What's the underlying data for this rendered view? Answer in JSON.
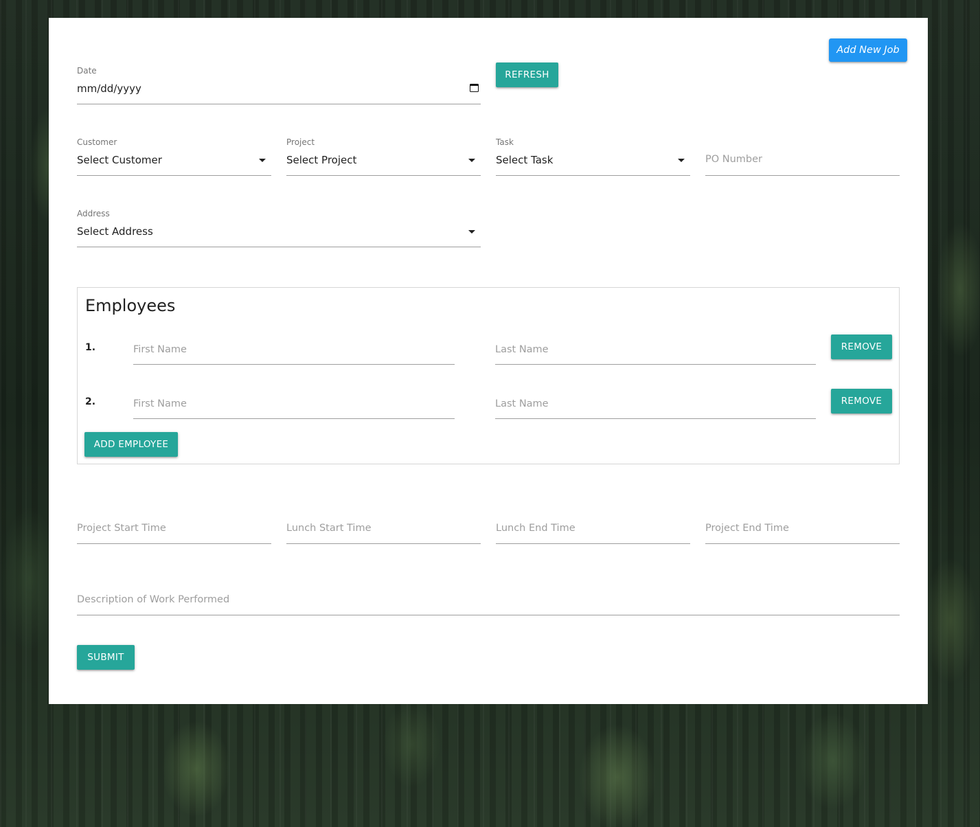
{
  "header": {
    "add_job_label": "Add New Job"
  },
  "date": {
    "label": "Date",
    "value": "mm/dd/yyyy"
  },
  "refresh_label": "REFRESH",
  "customer": {
    "label": "Customer",
    "value": "Select Customer"
  },
  "project": {
    "label": "Project",
    "value": "Select Project"
  },
  "task": {
    "label": "Task",
    "value": "Select Task"
  },
  "po_number": {
    "placeholder": "PO Number"
  },
  "address": {
    "label": "Address",
    "value": "Select Address"
  },
  "employees": {
    "title": "Employees",
    "rows": [
      {
        "number": "1.",
        "first_placeholder": "First Name",
        "last_placeholder": "Last Name",
        "remove_label": "REMOVE"
      },
      {
        "number": "2.",
        "first_placeholder": "First Name",
        "last_placeholder": "Last Name",
        "remove_label": "REMOVE"
      }
    ],
    "add_label": "ADD EMPLOYEE"
  },
  "times": {
    "project_start": "Project Start Time",
    "lunch_start": "Lunch Start Time",
    "lunch_end": "Lunch End Time",
    "project_end": "Project End Time"
  },
  "description": {
    "placeholder": "Description of Work Performed"
  },
  "submit_label": "SUBMIT",
  "colors": {
    "primary_teal": "#26a69a",
    "accent_blue": "#2196f3"
  }
}
